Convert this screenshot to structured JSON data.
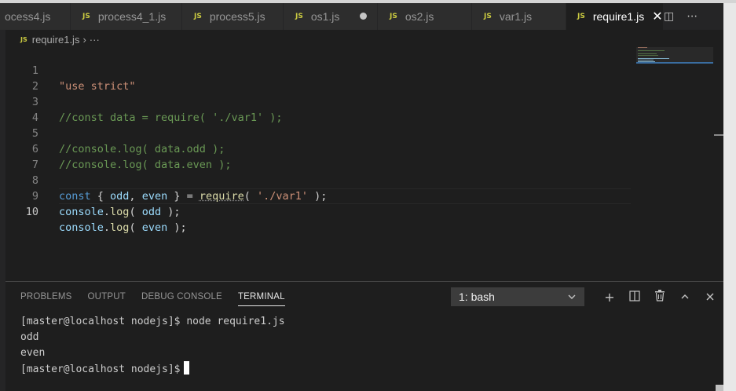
{
  "tabs": [
    {
      "label": "ocess4.js",
      "badge": ""
    },
    {
      "label": "process4_1.js",
      "badge": "JS"
    },
    {
      "label": "process5.js",
      "badge": "JS"
    },
    {
      "label": "os1.js",
      "badge": "JS"
    },
    {
      "label": "os2.js",
      "badge": "JS"
    },
    {
      "label": "var1.js",
      "badge": "JS"
    },
    {
      "label": "require1.js",
      "badge": "JS",
      "close": "✕"
    }
  ],
  "tab_actions": {
    "split": "◫",
    "more": "⋯"
  },
  "breadcrumb": {
    "badge": "JS",
    "file": "require1.js",
    "sep": "›",
    "more": "···"
  },
  "editor": {
    "line_numbers": [
      "1",
      "2",
      "3",
      "4",
      "5",
      "6",
      "7",
      "8",
      "9",
      "10"
    ],
    "current_line": 10,
    "lines": {
      "l1": "\"use strict\"",
      "l3": "//const data = require( './var1' );",
      "l5": "//console.log( data.odd );",
      "l6": "//console.log( data.even );",
      "l8": {
        "kw": "const",
        "p1": " { ",
        "v1": "odd",
        "p2": ", ",
        "v2": "even",
        "p3": " } = ",
        "fn": "require",
        "p4": "( ",
        "str": "'./var1'",
        "p5": " );"
      },
      "l9": {
        "obj": "console",
        "dot": ".",
        "fn": "log",
        "p1": "( ",
        "arg": "odd",
        "p2": " );"
      },
      "l10": {
        "obj": "console",
        "dot": ".",
        "fn": "log",
        "p1": "( ",
        "arg": "even",
        "p2": " );"
      }
    }
  },
  "panel": {
    "tabs": [
      "PROBLEMS",
      "OUTPUT",
      "DEBUG CONSOLE",
      "TERMINAL"
    ],
    "active_tab": "TERMINAL",
    "terminal_select": "1: bash",
    "actions": {
      "add": "+",
      "split": "◫",
      "trash": "🗑",
      "maximize": "⌃",
      "close": "✕"
    }
  },
  "terminal": {
    "lines": [
      "[master@localhost nodejs]$ node require1.js",
      "odd",
      "even"
    ],
    "prompt": "[master@localhost nodejs]$"
  },
  "colors": {
    "editor_bg": "#1e1e1e",
    "tab_bg": "#2d2d2d",
    "js_badge": "#cbcb41",
    "string": "#ce9178",
    "comment": "#6a9955",
    "keyword": "#569cd6",
    "variable": "#9cdcfe",
    "function": "#dcdcaa"
  }
}
